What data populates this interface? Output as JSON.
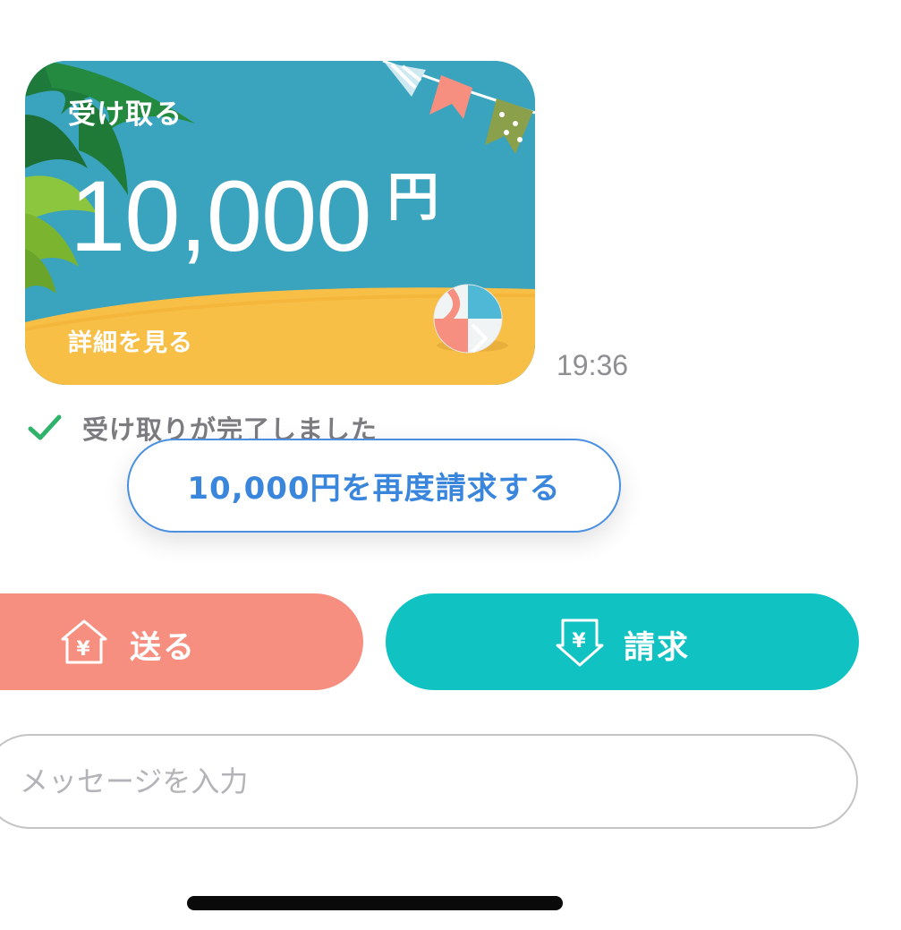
{
  "card": {
    "label": "受け取る",
    "amount": "10,000",
    "unit": "円",
    "detail_link": "詳細を見る"
  },
  "message_time": "19:36",
  "status": {
    "text": "受け取りが完了しました"
  },
  "rerequest_button": "10,000円を再度請求する",
  "actions": {
    "send_label": "送る",
    "request_label": "請求"
  },
  "message_input": {
    "placeholder": "メッセージを入力",
    "value": ""
  },
  "icons": {
    "send": "yen-house-icon",
    "request": "yen-down-arrow-icon",
    "status": "check-icon",
    "card_chevron": "chevron-right-icon"
  },
  "colors": {
    "card_sky": "#3aa3bd",
    "card_sand": "#f8bf47",
    "send_button": "#f78f80",
    "request_button": "#10c2c2",
    "rerequest_accent": "#3a86dc",
    "check": "#2fb36b"
  }
}
